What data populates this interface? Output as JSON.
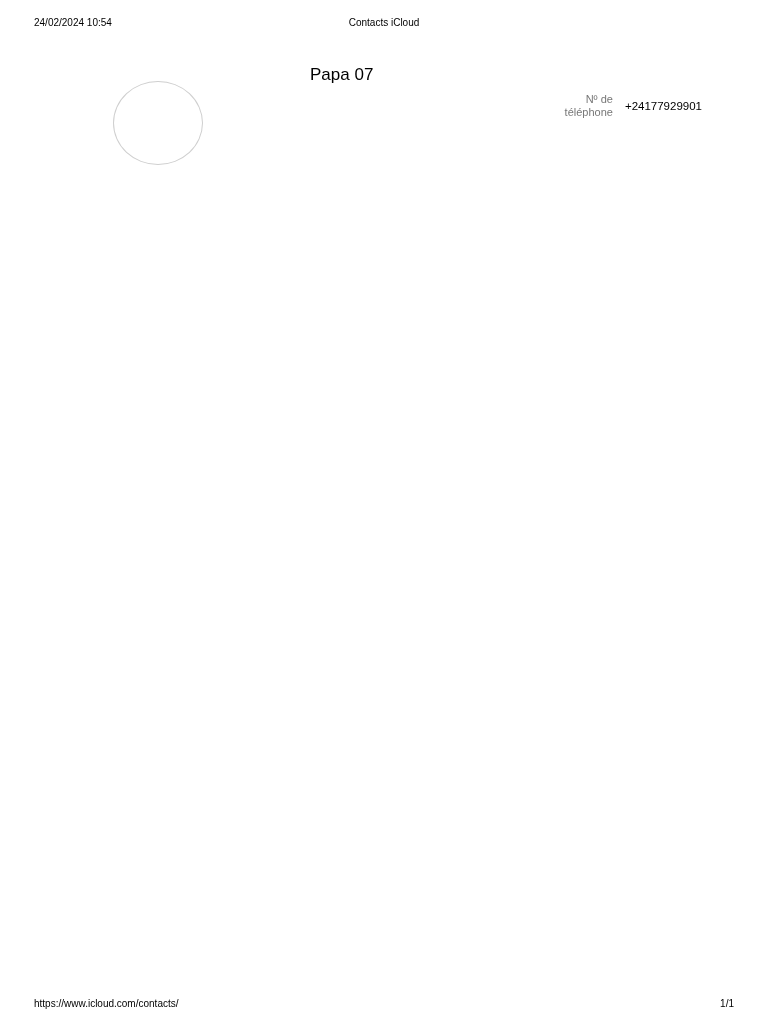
{
  "print_header": {
    "date": "24/02/2024 10:54",
    "title": "Contacts iCloud"
  },
  "contact": {
    "name": "Papa 07",
    "fields": [
      {
        "label": "Nº de téléphone",
        "value": "+24177929901"
      }
    ]
  },
  "print_footer": {
    "url": "https://www.icloud.com/contacts/",
    "page": "1/1"
  }
}
